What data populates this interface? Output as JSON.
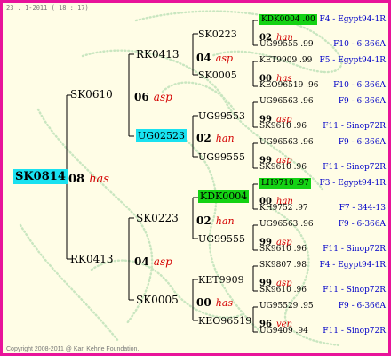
{
  "header": "23 . 1-2011 ( 18 : 17)",
  "footer": "Copyright 2008-2011 @ Karl Kehrle Foundation.",
  "colors": {
    "frame": "#e8139a",
    "background": "#fffde6",
    "year": "#d40000",
    "origin": "#0000c8",
    "highlight_cyan": "#19e1f0",
    "highlight_green": "#14d214"
  },
  "root": {
    "id": "SK0814",
    "year": "08",
    "mark": "has"
  },
  "gen1": [
    {
      "id": "SK0610",
      "year": "06",
      "mark": "asp"
    },
    {
      "id": "RK0413",
      "year": "04",
      "mark": "asp"
    }
  ],
  "gen2": [
    {
      "id": "RK0413",
      "year": "04",
      "mark": "asp"
    },
    {
      "id": "UG02523",
      "year": "02",
      "mark": "han"
    },
    {
      "id": "SK0223",
      "year": "02",
      "mark": "han"
    },
    {
      "id": "SK0005",
      "year": "00",
      "mark": "has"
    }
  ],
  "gen3": [
    {
      "id": "SK0223",
      "year": "04",
      "mark": "asp"
    },
    {
      "id": "SK0005"
    },
    {
      "id": "UG99553",
      "year": "02",
      "mark": "han"
    },
    {
      "id": "UG99555"
    },
    {
      "id": "KDK0004",
      "year": "02",
      "mark": "han"
    },
    {
      "id": "UG99555"
    },
    {
      "id": "KET9909",
      "year": "00",
      "mark": "has"
    },
    {
      "id": "KEO96519"
    }
  ],
  "gen4": [
    {
      "id": "KDK0004 .00",
      "year": "02",
      "mark": "han",
      "origin": "F4 - Egypt94-1R"
    },
    {
      "id": "UG99555 .99",
      "origin": "F10 - 6-366A"
    },
    {
      "id": "KET9909 .99",
      "year": "00",
      "mark": "has",
      "origin": "F5 - Egypt94-1R"
    },
    {
      "id": "KEO96519 .96",
      "origin": "F10 - 6-366A"
    },
    {
      "id": "UG96563 .96",
      "year": "99",
      "mark": "asp",
      "origin": "F9 - 6-366A"
    },
    {
      "id": "SK9610 .96",
      "origin": "F11 - Sinop72R"
    },
    {
      "id": "UG96563 .96",
      "year": "99",
      "mark": "asp",
      "origin": "F9 - 6-366A"
    },
    {
      "id": "SK9610 .96",
      "origin": "F11 - Sinop72R"
    },
    {
      "id": "LH9710 .97",
      "year": "00",
      "mark": "han",
      "origin": "F3 - Egypt94-1R"
    },
    {
      "id": "KH9752 .97",
      "origin": "F7 - 344-13"
    },
    {
      "id": "UG96563 .96",
      "year": "99",
      "mark": "asp",
      "origin": "F9 - 6-366A"
    },
    {
      "id": "SK9610 .96",
      "origin": "F11 - Sinop72R"
    },
    {
      "id": "SK9807 .98",
      "year": "99",
      "mark": "asp",
      "origin": "F4 - Egypt94-1R"
    },
    {
      "id": "SK9610 .96",
      "origin": "F11 - Sinop72R"
    },
    {
      "id": "UG95529 .95",
      "year": "96",
      "mark": "ven",
      "origin": "F9 - 6-366A"
    },
    {
      "id": "UG9409 .94",
      "origin": "F11 - Sinop72R"
    }
  ]
}
